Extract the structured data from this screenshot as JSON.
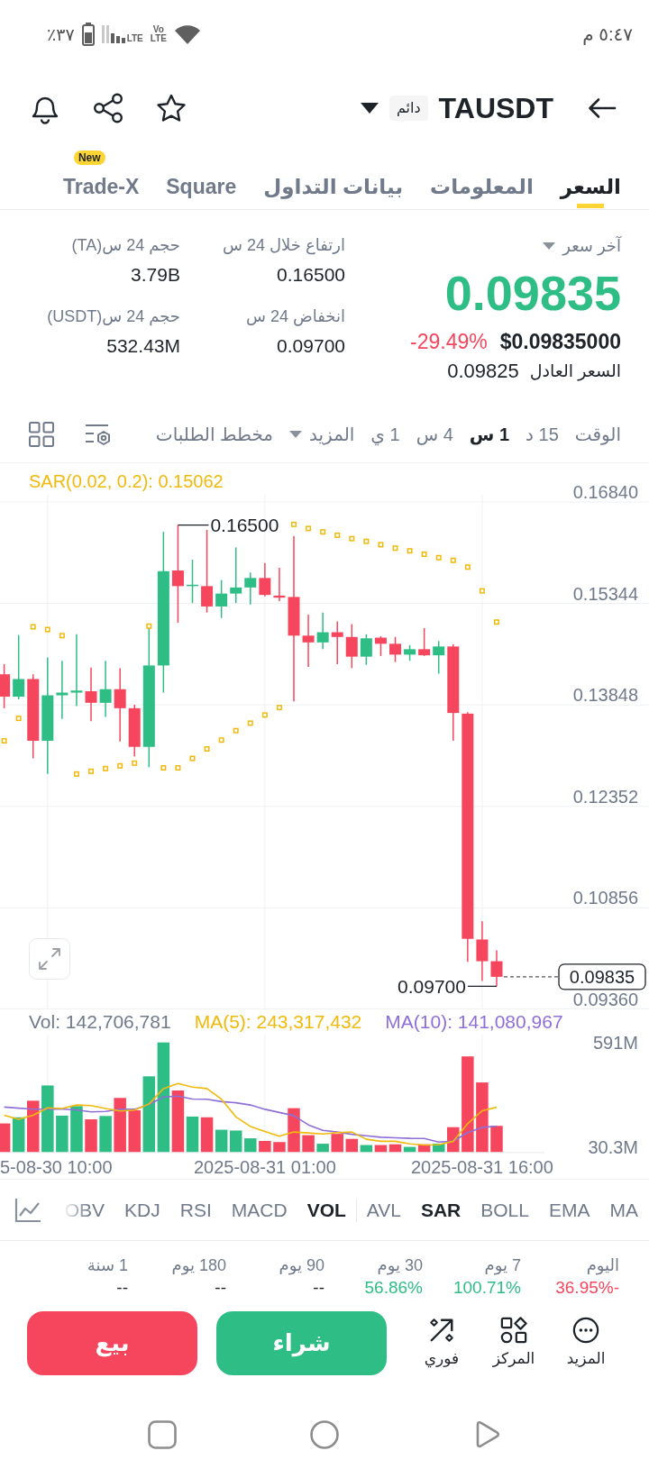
{
  "status_bar": {
    "time": "٥:٤٧ م",
    "battery": "٣٧٪",
    "network": "LTE",
    "volte": [
      "Vo",
      "LTE"
    ]
  },
  "header": {
    "symbol": "TAUSDT",
    "badge": "دائم"
  },
  "tabs": [
    {
      "label": "السعر",
      "selected": true
    },
    {
      "label": "المعلومات",
      "selected": false
    },
    {
      "label": "بيانات التداول",
      "selected": false
    },
    {
      "label": "Square",
      "selected": false
    },
    {
      "label": "Trade-X",
      "selected": false,
      "badge": "New"
    }
  ],
  "price": {
    "label": "آخر سعر",
    "value": "0.09835",
    "rising": true,
    "usd_value": "$0.09835000",
    "change": {
      "text": "-29.49%",
      "rising": false
    },
    "fair_price_label": "السعر العادل",
    "fair_price": "0.09825"
  },
  "stat_columns": [
    {
      "items": [
        {
          "label": "ارتفاع خلال 24 س",
          "value": "0.16500"
        },
        {
          "label": "انخفاض 24 س",
          "value": "0.09700"
        }
      ]
    },
    {
      "items": [
        {
          "label": "حجم 24 س(TA)",
          "value": "3.79B"
        },
        {
          "label": "حجم 24 س(USDT)",
          "value": "532.43M"
        }
      ]
    }
  ],
  "timeframe": {
    "label": "الوقت",
    "intervals": [
      {
        "label": "15 د",
        "selected": false
      },
      {
        "label": "1 س",
        "selected": true
      },
      {
        "label": "4 س",
        "selected": false
      },
      {
        "label": "1 ي",
        "selected": false
      }
    ],
    "more": "المزيد",
    "depth_chart": "مخطط الطلبات"
  },
  "price_chart": {
    "legend": "SAR(0.02, 0.2): 0.15062",
    "high_label": "0.16500",
    "low_label": "0.09700",
    "last_price_tag": "0.09835",
    "chart_data": {
      "type": "candlestick",
      "categories": [
        null,
        null,
        null,
        null,
        null,
        null,
        null,
        null,
        null,
        null,
        null,
        null,
        null,
        null,
        null,
        null,
        null,
        null,
        null,
        null,
        null,
        null,
        null,
        null,
        null,
        null,
        null,
        null,
        null,
        null,
        null,
        null,
        null,
        null,
        null
      ],
      "ylim": [
        0.0936,
        0.17425
      ],
      "yticks": [
        {
          "value": 0.1684,
          "label": "0.16840"
        },
        {
          "value": 0.15344,
          "label": "0.15344"
        },
        {
          "value": 0.13848,
          "label": "0.13848"
        },
        {
          "value": 0.12352,
          "label": "0.12352"
        },
        {
          "value": 0.10856,
          "label": "0.10856"
        },
        {
          "value": 0.0936,
          "label": "0.09360"
        }
      ],
      "grid": true,
      "ohlc": [
        [
          0.143,
          0.1445,
          0.138,
          0.1397
        ],
        [
          0.1397,
          0.1488,
          0.1393,
          0.1423
        ],
        [
          0.1423,
          0.143,
          0.1306,
          0.1332
        ],
        [
          0.1332,
          0.1455,
          0.1283,
          0.1399
        ],
        [
          0.1399,
          0.145,
          0.1364,
          0.1403
        ],
        [
          0.1403,
          0.1489,
          0.1383,
          0.1406
        ],
        [
          0.1405,
          0.144,
          0.1361,
          0.1388
        ],
        [
          0.1388,
          0.145,
          0.1367,
          0.1408
        ],
        [
          0.1408,
          0.1439,
          0.1331,
          0.138
        ],
        [
          0.138,
          0.1385,
          0.1309,
          0.1323
        ],
        [
          0.1323,
          0.1501,
          0.1293,
          0.1443
        ],
        [
          0.1443,
          0.164,
          0.1403,
          0.1582
        ],
        [
          0.1583,
          0.165,
          0.1506,
          0.156
        ],
        [
          0.156,
          0.1599,
          0.1535,
          0.1562
        ],
        [
          0.156,
          0.1643,
          0.1521,
          0.153
        ],
        [
          0.153,
          0.1569,
          0.1513,
          0.1549
        ],
        [
          0.1549,
          0.1617,
          0.1535,
          0.1558
        ],
        [
          0.1558,
          0.158,
          0.1533,
          0.1572
        ],
        [
          0.1572,
          0.1594,
          0.1545,
          0.1547
        ],
        [
          0.1546,
          0.1587,
          0.1538,
          0.1543
        ],
        [
          0.1544,
          0.1634,
          0.139,
          0.1487
        ],
        [
          0.1487,
          0.1518,
          0.1441,
          0.1477
        ],
        [
          0.1477,
          0.1521,
          0.1467,
          0.1492
        ],
        [
          0.1492,
          0.1508,
          0.1445,
          0.1485
        ],
        [
          0.1485,
          0.1504,
          0.1439,
          0.1456
        ],
        [
          0.1456,
          0.1489,
          0.1444,
          0.1483
        ],
        [
          0.1484,
          0.1486,
          0.1457,
          0.1475
        ],
        [
          0.1475,
          0.1485,
          0.1448,
          0.1459
        ],
        [
          0.1459,
          0.1473,
          0.145,
          0.1467
        ],
        [
          0.1467,
          0.1498,
          0.1457,
          0.1458
        ],
        [
          0.1458,
          0.1479,
          0.1431,
          0.1471
        ],
        [
          0.1471,
          0.1474,
          0.1332,
          0.1373
        ],
        [
          0.1372,
          0.1374,
          0.1006,
          0.104
        ],
        [
          0.1039,
          0.1066,
          0.0978,
          0.1007
        ],
        [
          0.1007,
          0.1023,
          0.097,
          0.0984
        ]
      ]
    }
  },
  "volume_chart": {
    "legend": [
      {
        "text": "MA(10): 141,080,967",
        "kind": "average"
      },
      {
        "text": "MA(5): 243,317,432",
        "kind": "average"
      },
      {
        "text": "Vol: 142,706,781",
        "kind": "volume"
      }
    ],
    "chart_data": {
      "type": "bar",
      "categories": [
        null,
        null,
        null,
        "5-08-30 10:00",
        null,
        null,
        null,
        null,
        null,
        null,
        null,
        null,
        null,
        null,
        null,
        null,
        null,
        null,
        "2025-08-31 01:00",
        null,
        null,
        null,
        null,
        null,
        null,
        null,
        null,
        null,
        null,
        null,
        null,
        null,
        null,
        "2025-08-31 16:00",
        null
      ],
      "ylim": [
        0,
        591
      ],
      "yticks": [
        {
          "value": 591,
          "label": "591M"
        },
        {
          "value": 30.3,
          "label": "30.3M"
        }
      ],
      "grid": true,
      "series": [
        {
          "values": [
            156,
            189,
            278,
            360,
            198,
            249,
            178,
            196,
            293,
            227,
            409,
            591,
            333,
            193,
            189,
            122,
            118,
            76,
            62,
            56,
            238,
            93,
            47,
            100,
            73,
            40,
            40,
            44,
            30,
            44,
            47,
            136,
            516,
            376,
            143
          ]
        }
      ]
    }
  },
  "average_lines": {
    "chart_data": {
      "type": "line",
      "categories": [
        null,
        null,
        null,
        null,
        null,
        null,
        null,
        null,
        null,
        null,
        null,
        null,
        null,
        null,
        null,
        null,
        null,
        null,
        null,
        null,
        null,
        null,
        null,
        null,
        null,
        null,
        null,
        null,
        null,
        null,
        null,
        null,
        null,
        null,
        null
      ],
      "ylim": [
        0,
        591
      ],
      "series": [
        {
          "color": "#8e6fd9",
          "values": [
            244,
            238,
            233,
            233,
            233,
            229,
            218,
            220,
            233,
            232,
            258,
            298,
            303,
            287,
            286,
            273,
            267,
            255,
            232,
            215,
            198,
            148,
            119,
            110,
            98,
            90,
            82,
            79,
            76,
            75,
            56,
            60,
            107,
            135,
            141
          ]
        },
        {
          "color": "#f0b90b",
          "values": [
            200,
            178,
            200,
            240,
            236,
            255,
            252,
            236,
            223,
            228,
            260,
            343,
            371,
            351,
            343,
            286,
            191,
            140,
            113,
            87,
            110,
            105,
            99,
            107,
            110,
            71,
            60,
            60,
            46,
            40,
            41,
            60,
            155,
            224,
            243
          ]
        }
      ]
    }
  },
  "indicators": {
    "main": [
      {
        "label": "MA",
        "selected": false
      },
      {
        "label": "EMA",
        "selected": false
      },
      {
        "label": "BOLL",
        "selected": false
      },
      {
        "label": "SAR",
        "selected": true
      },
      {
        "label": "AVL",
        "selected": false
      }
    ],
    "sub": [
      {
        "label": "VOL",
        "selected": true
      },
      {
        "label": "MACD",
        "selected": false
      },
      {
        "label": "RSI",
        "selected": false
      },
      {
        "label": "KDJ",
        "selected": false
      },
      {
        "label": "OBV",
        "selected": false
      }
    ]
  },
  "performance": [
    {
      "label": "اليوم",
      "value": "-36.95%",
      "kind": "loss"
    },
    {
      "label": "7 يوم",
      "value": "100.71%",
      "kind": "gain"
    },
    {
      "label": "30 يوم",
      "value": "56.86%",
      "kind": "gain"
    },
    {
      "label": "90 يوم",
      "value": "--",
      "kind": "none"
    },
    {
      "label": "180 يوم",
      "value": "--",
      "kind": "none"
    },
    {
      "label": "1 سنة",
      "value": "--",
      "kind": "none"
    }
  ],
  "actions": [
    {
      "label": "المزيد"
    },
    {
      "label": "المركز"
    },
    {
      "label": "فوري"
    }
  ],
  "trade_buttons": [
    {
      "kind": "buy",
      "label": "شراء"
    },
    {
      "kind": "sell",
      "label": "بيع"
    }
  ]
}
